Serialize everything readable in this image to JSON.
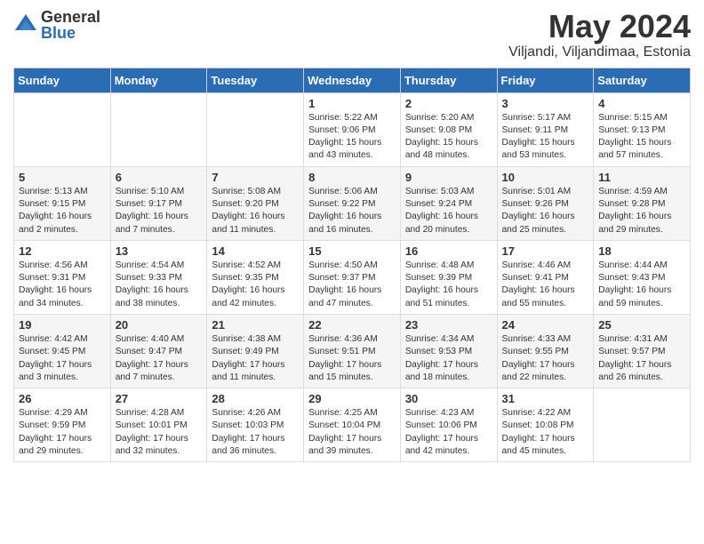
{
  "header": {
    "logo": {
      "general": "General",
      "blue": "Blue"
    },
    "title": "May 2024",
    "location": "Viljandi, Viljandimaa, Estonia"
  },
  "days_of_week": [
    "Sunday",
    "Monday",
    "Tuesday",
    "Wednesday",
    "Thursday",
    "Friday",
    "Saturday"
  ],
  "weeks": [
    [
      {
        "day": "",
        "info": ""
      },
      {
        "day": "",
        "info": ""
      },
      {
        "day": "",
        "info": ""
      },
      {
        "day": "1",
        "info": "Sunrise: 5:22 AM\nSunset: 9:06 PM\nDaylight: 15 hours and 43 minutes."
      },
      {
        "day": "2",
        "info": "Sunrise: 5:20 AM\nSunset: 9:08 PM\nDaylight: 15 hours and 48 minutes."
      },
      {
        "day": "3",
        "info": "Sunrise: 5:17 AM\nSunset: 9:11 PM\nDaylight: 15 hours and 53 minutes."
      },
      {
        "day": "4",
        "info": "Sunrise: 5:15 AM\nSunset: 9:13 PM\nDaylight: 15 hours and 57 minutes."
      }
    ],
    [
      {
        "day": "5",
        "info": "Sunrise: 5:13 AM\nSunset: 9:15 PM\nDaylight: 16 hours and 2 minutes."
      },
      {
        "day": "6",
        "info": "Sunrise: 5:10 AM\nSunset: 9:17 PM\nDaylight: 16 hours and 7 minutes."
      },
      {
        "day": "7",
        "info": "Sunrise: 5:08 AM\nSunset: 9:20 PM\nDaylight: 16 hours and 11 minutes."
      },
      {
        "day": "8",
        "info": "Sunrise: 5:06 AM\nSunset: 9:22 PM\nDaylight: 16 hours and 16 minutes."
      },
      {
        "day": "9",
        "info": "Sunrise: 5:03 AM\nSunset: 9:24 PM\nDaylight: 16 hours and 20 minutes."
      },
      {
        "day": "10",
        "info": "Sunrise: 5:01 AM\nSunset: 9:26 PM\nDaylight: 16 hours and 25 minutes."
      },
      {
        "day": "11",
        "info": "Sunrise: 4:59 AM\nSunset: 9:28 PM\nDaylight: 16 hours and 29 minutes."
      }
    ],
    [
      {
        "day": "12",
        "info": "Sunrise: 4:56 AM\nSunset: 9:31 PM\nDaylight: 16 hours and 34 minutes."
      },
      {
        "day": "13",
        "info": "Sunrise: 4:54 AM\nSunset: 9:33 PM\nDaylight: 16 hours and 38 minutes."
      },
      {
        "day": "14",
        "info": "Sunrise: 4:52 AM\nSunset: 9:35 PM\nDaylight: 16 hours and 42 minutes."
      },
      {
        "day": "15",
        "info": "Sunrise: 4:50 AM\nSunset: 9:37 PM\nDaylight: 16 hours and 47 minutes."
      },
      {
        "day": "16",
        "info": "Sunrise: 4:48 AM\nSunset: 9:39 PM\nDaylight: 16 hours and 51 minutes."
      },
      {
        "day": "17",
        "info": "Sunrise: 4:46 AM\nSunset: 9:41 PM\nDaylight: 16 hours and 55 minutes."
      },
      {
        "day": "18",
        "info": "Sunrise: 4:44 AM\nSunset: 9:43 PM\nDaylight: 16 hours and 59 minutes."
      }
    ],
    [
      {
        "day": "19",
        "info": "Sunrise: 4:42 AM\nSunset: 9:45 PM\nDaylight: 17 hours and 3 minutes."
      },
      {
        "day": "20",
        "info": "Sunrise: 4:40 AM\nSunset: 9:47 PM\nDaylight: 17 hours and 7 minutes."
      },
      {
        "day": "21",
        "info": "Sunrise: 4:38 AM\nSunset: 9:49 PM\nDaylight: 17 hours and 11 minutes."
      },
      {
        "day": "22",
        "info": "Sunrise: 4:36 AM\nSunset: 9:51 PM\nDaylight: 17 hours and 15 minutes."
      },
      {
        "day": "23",
        "info": "Sunrise: 4:34 AM\nSunset: 9:53 PM\nDaylight: 17 hours and 18 minutes."
      },
      {
        "day": "24",
        "info": "Sunrise: 4:33 AM\nSunset: 9:55 PM\nDaylight: 17 hours and 22 minutes."
      },
      {
        "day": "25",
        "info": "Sunrise: 4:31 AM\nSunset: 9:57 PM\nDaylight: 17 hours and 26 minutes."
      }
    ],
    [
      {
        "day": "26",
        "info": "Sunrise: 4:29 AM\nSunset: 9:59 PM\nDaylight: 17 hours and 29 minutes."
      },
      {
        "day": "27",
        "info": "Sunrise: 4:28 AM\nSunset: 10:01 PM\nDaylight: 17 hours and 32 minutes."
      },
      {
        "day": "28",
        "info": "Sunrise: 4:26 AM\nSunset: 10:03 PM\nDaylight: 17 hours and 36 minutes."
      },
      {
        "day": "29",
        "info": "Sunrise: 4:25 AM\nSunset: 10:04 PM\nDaylight: 17 hours and 39 minutes."
      },
      {
        "day": "30",
        "info": "Sunrise: 4:23 AM\nSunset: 10:06 PM\nDaylight: 17 hours and 42 minutes."
      },
      {
        "day": "31",
        "info": "Sunrise: 4:22 AM\nSunset: 10:08 PM\nDaylight: 17 hours and 45 minutes."
      },
      {
        "day": "",
        "info": ""
      }
    ]
  ]
}
